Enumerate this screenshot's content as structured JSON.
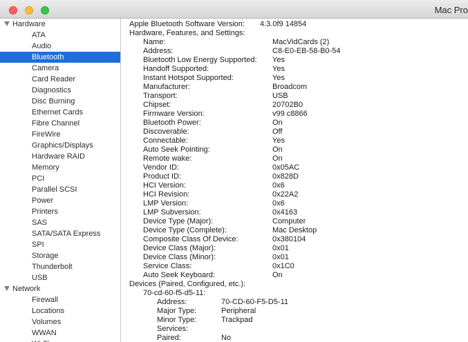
{
  "window": {
    "title": "Mac Pro"
  },
  "sidebar": {
    "hardware_header": "Hardware",
    "hardware_items": [
      "ATA",
      "Audio",
      "Bluetooth",
      "Camera",
      "Card Reader",
      "Diagnostics",
      "Disc Burning",
      "Ethernet Cards",
      "Fibre Channel",
      "FireWire",
      "Graphics/Displays",
      "Hardware RAID",
      "Memory",
      "PCI",
      "Parallel SCSI",
      "Power",
      "Printers",
      "SAS",
      "SATA/SATA Express",
      "SPI",
      "Storage",
      "Thunderbolt",
      "USB"
    ],
    "selected_item": "Bluetooth",
    "network_header": "Network",
    "network_items": [
      "Firewall",
      "Locations",
      "Volumes",
      "WWAN",
      "Wi-Fi"
    ]
  },
  "content": {
    "software_version_label": "Apple Bluetooth Software Version:",
    "software_version_value": "4.3.0f9 14854",
    "hardware_section": "Hardware, Features, and Settings:",
    "properties": [
      [
        "Name:",
        "MacVidCards (2)"
      ],
      [
        "Address:",
        "C8-E0-EB-58-B0-54"
      ],
      [
        "Bluetooth Low Energy Supported:",
        "Yes"
      ],
      [
        "Handoff Supported:",
        "Yes"
      ],
      [
        "Instant Hotspot Supported:",
        "Yes"
      ],
      [
        "Manufacturer:",
        "Broadcom"
      ],
      [
        "Transport:",
        "USB"
      ],
      [
        "Chipset:",
        "20702B0"
      ],
      [
        "Firmware Version:",
        "v99 c8866"
      ],
      [
        "Bluetooth Power:",
        "On"
      ],
      [
        "Discoverable:",
        "Off"
      ],
      [
        "Connectable:",
        "Yes"
      ],
      [
        "Auto Seek Pointing:",
        "On"
      ],
      [
        "Remote wake:",
        "On"
      ],
      [
        "Vendor ID:",
        "0x05AC"
      ],
      [
        "Product ID:",
        "0x828D"
      ],
      [
        "HCI Version:",
        "0x6"
      ],
      [
        "HCI Revision:",
        "0x22A2"
      ],
      [
        "LMP Version:",
        "0x6"
      ],
      [
        "LMP Subversion:",
        "0x4163"
      ],
      [
        "Device Type (Major):",
        "Computer"
      ],
      [
        "Device Type (Complete):",
        "Mac Desktop"
      ],
      [
        "Composite Class Of Device:",
        "0x380104"
      ],
      [
        "Device Class (Major):",
        "0x01"
      ],
      [
        "Device Class (Minor):",
        "0x01"
      ],
      [
        "Service Class:",
        "0x1C0"
      ],
      [
        "Auto Seek Keyboard:",
        "On"
      ]
    ],
    "devices_section": "Devices (Paired, Configured, etc.):",
    "device_name": "70-cd-60-f5-d5-11:",
    "device_properties": [
      [
        "Address:",
        "70-CD-60-F5-D5-11"
      ],
      [
        "Major Type:",
        "Peripheral"
      ],
      [
        "Minor Type:",
        "Trackpad"
      ],
      [
        "Services:",
        ""
      ],
      [
        "Paired:",
        "No"
      ]
    ]
  }
}
